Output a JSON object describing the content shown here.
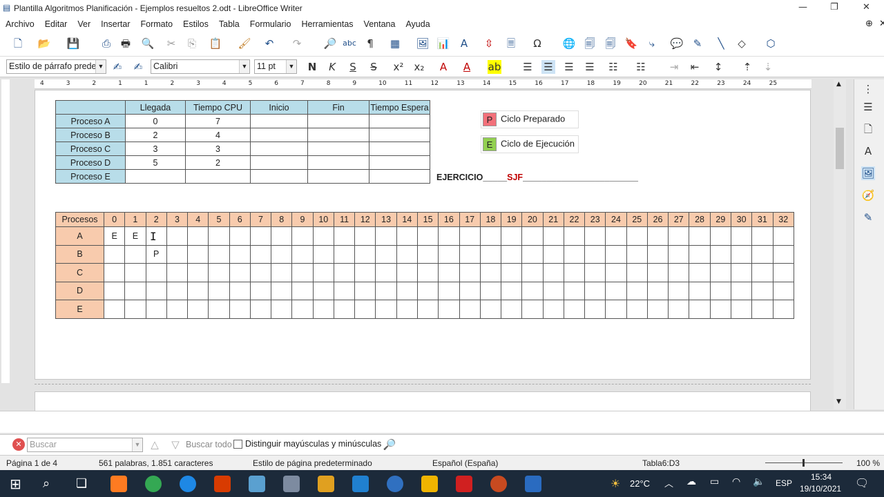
{
  "window": {
    "title": "Plantilla Algoritmos Planificación - Ejemplos resueltos 2.odt - LibreOffice Writer"
  },
  "menu": [
    "Archivo",
    "Editar",
    "Ver",
    "Insertar",
    "Formato",
    "Estilos",
    "Tabla",
    "Formulario",
    "Herramientas",
    "Ventana",
    "Ayuda"
  ],
  "format": {
    "paragraph_style": "Estilo de párrafo predet",
    "font_name": "Calibri",
    "font_size": "11 pt"
  },
  "ruler": {
    "marks": [
      "4",
      "3",
      "2",
      "1",
      "1",
      "2",
      "3",
      "4",
      "5",
      "6",
      "7",
      "8",
      "9",
      "10",
      "11",
      "12",
      "13",
      "14",
      "15",
      "16",
      "17",
      "18",
      "19",
      "20",
      "21",
      "22",
      "23",
      "24",
      "25"
    ]
  },
  "table1": {
    "headers": [
      "",
      "Llegada",
      "Tiempo CPU",
      "Inicio",
      "Fin",
      "Tiempo Espera"
    ],
    "rows": [
      [
        "Proceso  A",
        "0",
        "7",
        "",
        "",
        ""
      ],
      [
        "Proceso  B",
        "2",
        "4",
        "",
        "",
        ""
      ],
      [
        "Proceso  C",
        "3",
        "3",
        "",
        "",
        ""
      ],
      [
        "Proceso  D",
        "5",
        "2",
        "",
        "",
        ""
      ],
      [
        "Proceso  E",
        "",
        "",
        "",
        "",
        ""
      ]
    ]
  },
  "legend": [
    {
      "code": "P",
      "label": "Ciclo Preparado",
      "color": "#f2707a"
    },
    {
      "code": "E",
      "label": "Ciclo de Ejecución",
      "color": "#92d050"
    }
  ],
  "exercise": {
    "prefix": "EJERCICIO_____",
    "algo": "SJF",
    "suffix": "________________________"
  },
  "gantt": {
    "header": "Procesos",
    "columns": [
      "0",
      "1",
      "2",
      "3",
      "4",
      "5",
      "6",
      "7",
      "8",
      "9",
      "10",
      "11",
      "12",
      "13",
      "14",
      "15",
      "16",
      "17",
      "18",
      "19",
      "20",
      "21",
      "22",
      "23",
      "24",
      "25",
      "26",
      "27",
      "28",
      "29",
      "30",
      "31",
      "32"
    ],
    "rows": [
      {
        "label": "A",
        "cells": {
          "0": "E",
          "1": "E"
        }
      },
      {
        "label": "B",
        "cells": {
          "2": "P"
        }
      },
      {
        "label": "C",
        "cells": {}
      },
      {
        "label": "D",
        "cells": {}
      },
      {
        "label": "E",
        "cells": {}
      }
    ]
  },
  "find": {
    "placeholder": "Buscar",
    "find_all": "Buscar todo",
    "match_case": "Distinguir mayúsculas y minúsculas"
  },
  "status": {
    "page": "Página 1 de 4",
    "words": "561 palabras, 1.851 caracteres",
    "page_style": "Estilo de página predeterminado",
    "language": "Español (España)",
    "table_cell": "Tabla6:D3",
    "zoom": "100 %"
  },
  "taskbar": {
    "weather": "22°C",
    "lang": "ESP",
    "time": "15:34",
    "date": "19/10/2021"
  }
}
